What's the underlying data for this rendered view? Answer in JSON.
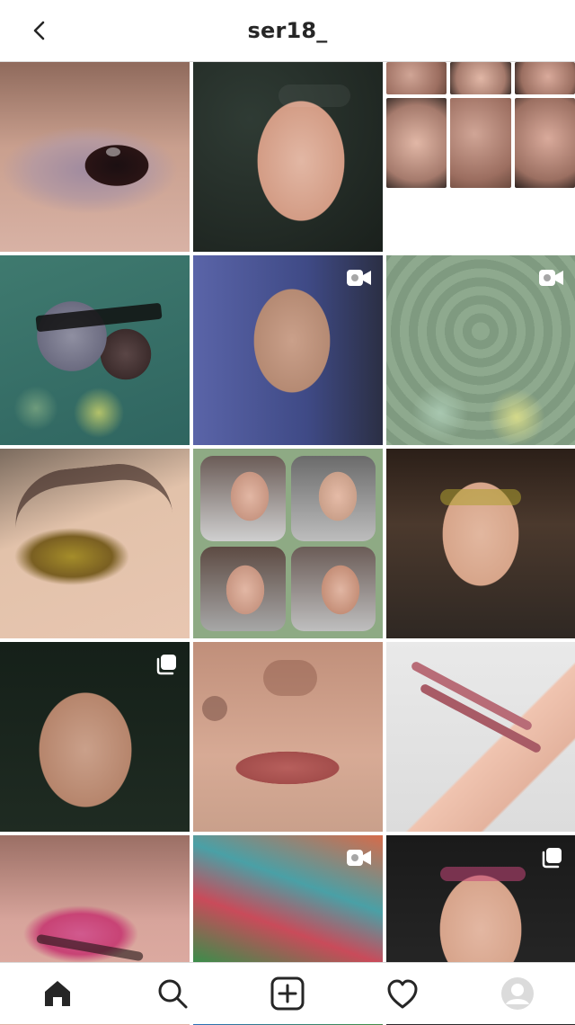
{
  "header": {
    "title": "ser18_"
  },
  "colors": {
    "background": "#ffffff",
    "divider": "#dbdbdb",
    "text": "#262626",
    "icon": "#262626"
  },
  "grid": {
    "tiles": [
      {
        "badge": ""
      },
      {
        "badge": ""
      },
      {
        "badge": ""
      },
      {
        "badge": ""
      },
      {
        "badge": "video"
      },
      {
        "badge": "video"
      },
      {
        "badge": ""
      },
      {
        "badge": ""
      },
      {
        "badge": ""
      },
      {
        "badge": "carousel"
      },
      {
        "badge": ""
      },
      {
        "badge": ""
      },
      {
        "badge": ""
      },
      {
        "badge": "video"
      },
      {
        "badge": "carousel"
      }
    ]
  },
  "bottom_nav": {
    "items": [
      {
        "icon": "home-icon"
      },
      {
        "icon": "search-icon"
      },
      {
        "icon": "add-post-icon"
      },
      {
        "icon": "heart-icon"
      },
      {
        "icon": "profile-avatar"
      }
    ]
  }
}
